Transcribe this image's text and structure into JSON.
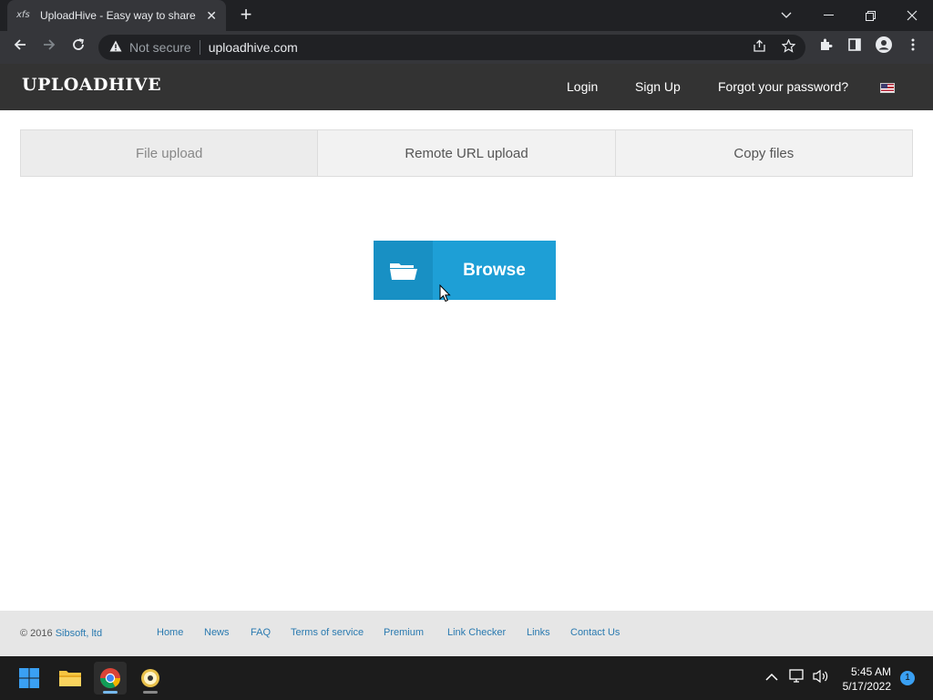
{
  "browser": {
    "tab_favicon": "xfs",
    "tab_title": "UploadHive - Easy way to share y",
    "tab_close": "✕",
    "new_tab": "+",
    "security_label": "Not secure",
    "url": "uploadhive.com"
  },
  "site": {
    "logo": "UPLOADHIVE",
    "nav": {
      "login": "Login",
      "signup": "Sign Up",
      "forgot": "Forgot your password?"
    }
  },
  "upload": {
    "tabs": [
      {
        "label": "File upload",
        "active": true
      },
      {
        "label": "Remote URL upload",
        "active": false
      },
      {
        "label": "Copy files",
        "active": false
      }
    ],
    "browse_label": "Browse"
  },
  "footer": {
    "copyright_prefix": "© 2016",
    "copyright_link": "Sibsoft, ltd",
    "links": [
      "Home",
      "News",
      "FAQ",
      "Terms of service",
      "Premium",
      "Link Checker",
      "Links",
      "Contact Us"
    ]
  },
  "taskbar": {
    "time": "5:45 AM",
    "date": "5/17/2022",
    "notifications": "1"
  },
  "colors": {
    "browse_blue": "#1e9fd6",
    "header_bg": "#333333",
    "link_blue": "#2a7ab0"
  }
}
